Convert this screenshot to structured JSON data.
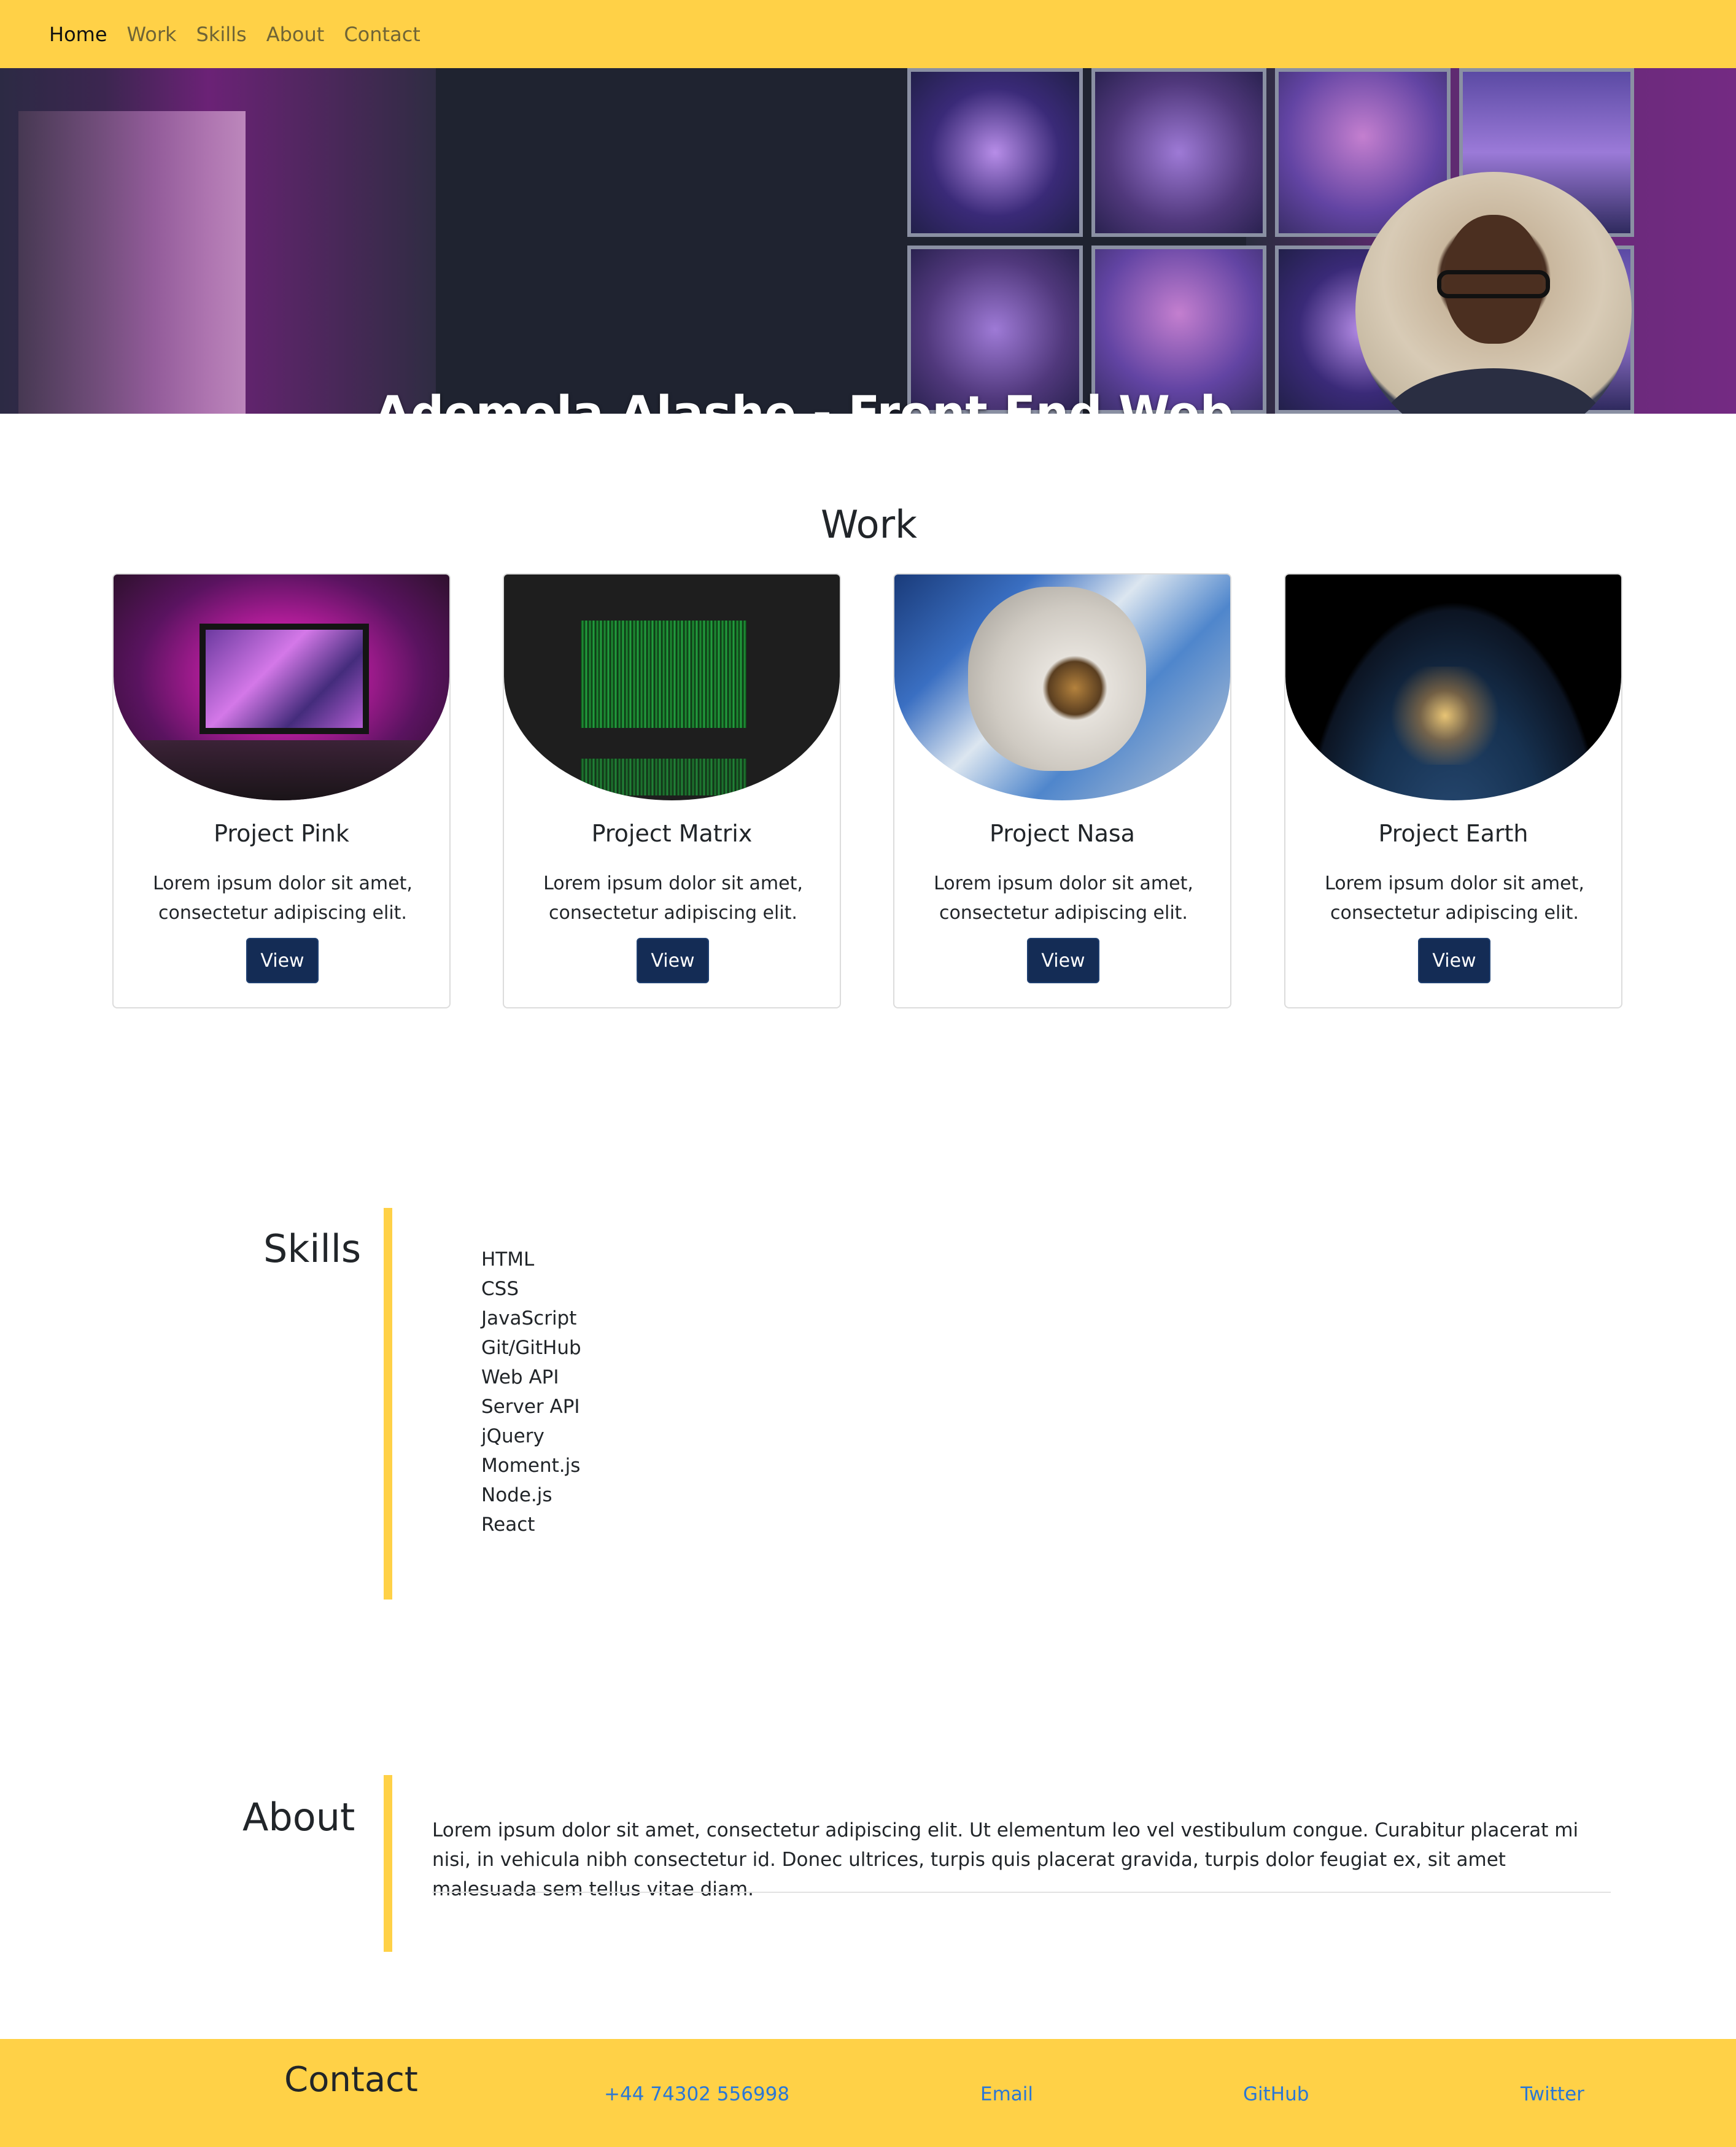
{
  "nav": {
    "items": [
      {
        "label": "Home",
        "active": true
      },
      {
        "label": "Work"
      },
      {
        "label": "Skills"
      },
      {
        "label": "About"
      },
      {
        "label": "Contact"
      }
    ]
  },
  "hero": {
    "title": "Ademola Alashe - Front End Web Developer"
  },
  "work": {
    "heading": "Work",
    "projects": [
      {
        "title": "Project Pink",
        "text": "Lorem ipsum dolor sit amet, consectetur adipiscing elit.",
        "button": "View"
      },
      {
        "title": "Project Matrix",
        "text": "Lorem ipsum dolor sit amet, consectetur adipiscing elit.",
        "button": "View"
      },
      {
        "title": "Project Nasa",
        "text": "Lorem ipsum dolor sit amet, consectetur adipiscing elit.",
        "button": "View"
      },
      {
        "title": "Project Earth",
        "text": "Lorem ipsum dolor sit amet, consectetur adipiscing elit.",
        "button": "View"
      }
    ]
  },
  "skills": {
    "heading": "Skills",
    "items": [
      "HTML",
      "CSS",
      "JavaScript",
      "Git/GitHub",
      "Web API",
      "Server API",
      "jQuery",
      "Moment.js",
      "Node.js",
      "React"
    ]
  },
  "about": {
    "heading": "About",
    "text": "Lorem ipsum dolor sit amet, consectetur adipiscing elit. Ut elementum leo vel vestibulum congue. Curabitur placerat mi nisi, in vehicula nibh consectetur id. Donec ultrices, turpis quis placerat gravida, turpis dolor feugiat ex, sit amet malesuada sem tellus vitae diam."
  },
  "contact": {
    "heading": "Contact",
    "phone": "+44 74302 556998",
    "email": "Email",
    "github": "GitHub",
    "twitter": "Twitter"
  },
  "colors": {
    "accent": "#ffd147",
    "button": "#142c55",
    "link": "#2a77d6"
  }
}
